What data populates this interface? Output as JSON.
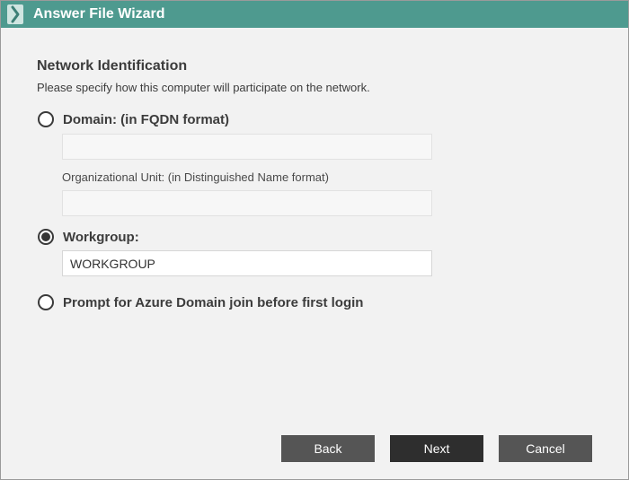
{
  "window": {
    "title": "Answer File Wizard",
    "title_bar_color": "#4e9a8f",
    "icon": "chevron-right-icon"
  },
  "section": {
    "title": "Network Identification",
    "description": "Please specify how this computer will participate on the network."
  },
  "options": {
    "domain": {
      "label": "Domain: (in FQDN format)",
      "selected": false,
      "value": ""
    },
    "organizational_unit": {
      "label": "Organizational Unit: (in Distinguished Name format)",
      "value": ""
    },
    "workgroup": {
      "label": "Workgroup:",
      "selected": true,
      "value": "WORKGROUP"
    },
    "azure": {
      "label": "Prompt for Azure Domain join before first login",
      "selected": false
    }
  },
  "buttons": {
    "back": "Back",
    "next": "Next",
    "cancel": "Cancel"
  }
}
